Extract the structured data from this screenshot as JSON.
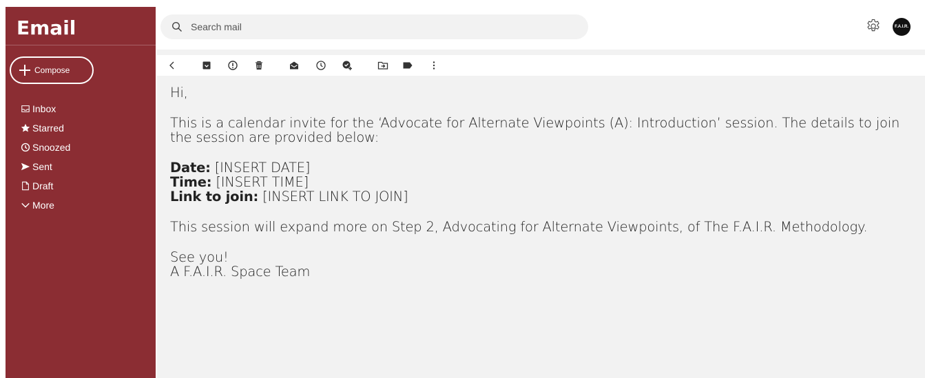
{
  "sidebar": {
    "brand": "Email",
    "compose_label": "Compose",
    "items": [
      {
        "label": "Inbox",
        "icon": "inbox-icon"
      },
      {
        "label": "Starred",
        "icon": "star-icon"
      },
      {
        "label": "Snoozed",
        "icon": "clock-icon"
      },
      {
        "label": "Sent",
        "icon": "send-icon"
      },
      {
        "label": "Draft",
        "icon": "file-icon"
      },
      {
        "label": "More",
        "icon": "chevron-down-icon"
      }
    ]
  },
  "header": {
    "search_placeholder": "Search mail",
    "avatar_text": "F.A.I.R."
  },
  "toolbar": {
    "icons": [
      "back-icon",
      "archive-icon",
      "report-spam-icon",
      "delete-icon",
      "mark-unread-icon",
      "snooze-icon",
      "add-task-icon",
      "move-to-icon",
      "label-icon",
      "more-vert-icon"
    ]
  },
  "email": {
    "greeting": "Hi,",
    "intro": "This is a calendar invite for the ‘Advocate for Alternate Viewpoints (A): Introduction’ session. The details to join the session are provided below:",
    "date_label": "Date:",
    "date_value": " [INSERT DATE]",
    "time_label": "Time:",
    "time_value": " [INSERT TIME]",
    "link_label": "Link to join:",
    "link_value": " [INSERT LINK TO JOIN]",
    "closing_text": "This session will expand more on Step 2, Advocating for Alternate Viewpoints, of The F.A.I.R. Methodology.",
    "signoff": "See you!",
    "signature": "A F.A.I.R. Space Team"
  },
  "colors": {
    "sidebar": "#8b2d33",
    "content_bg": "#f2f2f2",
    "text": "#222222"
  }
}
